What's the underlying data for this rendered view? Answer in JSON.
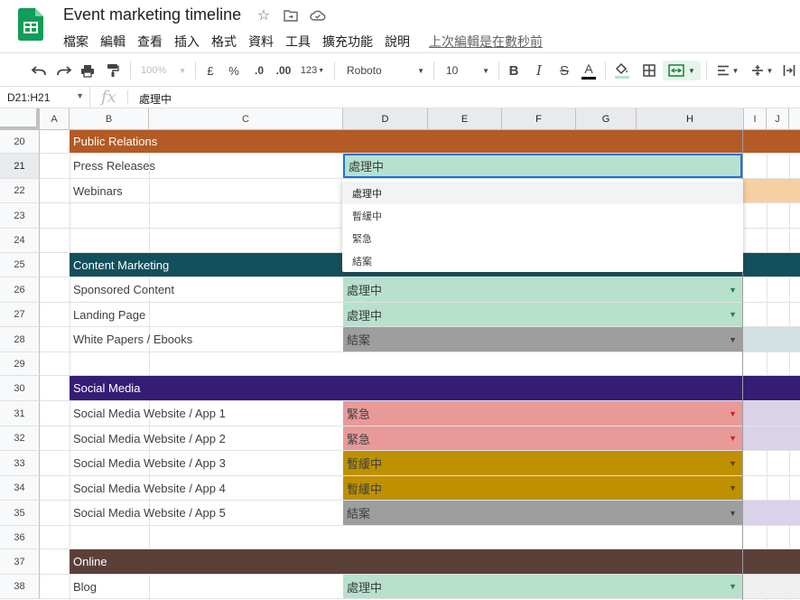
{
  "app": {
    "title": "Event marketing timeline",
    "menu": [
      "檔案",
      "編輯",
      "查看",
      "插入",
      "格式",
      "資料",
      "工具",
      "擴充功能",
      "說明"
    ],
    "last_edit": "上次編輯是在數秒前"
  },
  "toolbar": {
    "zoom": "100%",
    "currency": "£",
    "percent": "%",
    "dec_decrease": ".0",
    "dec_increase": ".00",
    "number_format": "123",
    "font": "Roboto",
    "font_size": "10"
  },
  "formula_bar": {
    "name_box": "D21:H21",
    "fx": "fx",
    "value": "處理中"
  },
  "columns": [
    "A",
    "B",
    "C",
    "D",
    "E",
    "F",
    "G",
    "H",
    "I",
    "J"
  ],
  "rows": [
    {
      "num": "20",
      "type": "section",
      "text": "Public Relations",
      "color": "#b45a24"
    },
    {
      "num": "21",
      "type": "item",
      "text": "Press Releases",
      "status": "處理中",
      "status_color": "#b7e1cd",
      "tail": "",
      "selected": true
    },
    {
      "num": "22",
      "type": "item",
      "text": "Webinars",
      "status": "",
      "status_color": "",
      "tail": "#f6cfa3"
    },
    {
      "num": "23",
      "type": "blank"
    },
    {
      "num": "24",
      "type": "blank"
    },
    {
      "num": "25",
      "type": "section",
      "text": "Content Marketing",
      "color": "#134f5c"
    },
    {
      "num": "26",
      "type": "item",
      "text": "Sponsored Content",
      "status": "處理中",
      "status_color": "#b7e1cd",
      "arrow_color": "#2e7d4f"
    },
    {
      "num": "27",
      "type": "item",
      "text": "Landing Page",
      "status": "處理中",
      "status_color": "#b7e1cd",
      "arrow_color": "#2e7d4f"
    },
    {
      "num": "28",
      "type": "item",
      "text": "White Papers / Ebooks",
      "status": "結案",
      "status_color": "#9e9e9e",
      "arrow_color": "#424242",
      "tail": "#d0e0e3"
    },
    {
      "num": "29",
      "type": "blank"
    },
    {
      "num": "30",
      "type": "section",
      "text": "Social Media",
      "color": "#351c75"
    },
    {
      "num": "31",
      "type": "item",
      "text": "Social Media Website / App 1",
      "status": "緊急",
      "status_color": "#ea9999",
      "arrow_color": "#c62828",
      "tail": "#d9d2e9"
    },
    {
      "num": "32",
      "type": "item",
      "text": "Social Media Website / App 2",
      "status": "緊急",
      "status_color": "#ea9999",
      "arrow_color": "#c62828",
      "tail": "#d9d2e9"
    },
    {
      "num": "33",
      "type": "item",
      "text": "Social Media Website / App 3",
      "status": "暫緩中",
      "status_color": "#bf9000",
      "arrow_color": "#5d4200"
    },
    {
      "num": "34",
      "type": "item",
      "text": "Social Media Website / App 4",
      "status": "暫緩中",
      "status_color": "#bf9000",
      "arrow_color": "#5d4200"
    },
    {
      "num": "35",
      "type": "item",
      "text": "Social Media Website / App 5",
      "status": "結案",
      "status_color": "#9e9e9e",
      "arrow_color": "#424242",
      "tail": "#d9d2e9"
    },
    {
      "num": "36",
      "type": "blank"
    },
    {
      "num": "37",
      "type": "section",
      "text": "Online",
      "color": "#5b4039"
    },
    {
      "num": "38",
      "type": "item",
      "text": "Blog",
      "status": "處理中",
      "status_color": "#b7e1cd",
      "arrow_color": "#2e7d4f",
      "tail": "#efefef"
    }
  ],
  "dropdown": {
    "options": [
      "處理中",
      "暫緩中",
      "緊急",
      "結案"
    ],
    "highlighted": "處理中"
  }
}
